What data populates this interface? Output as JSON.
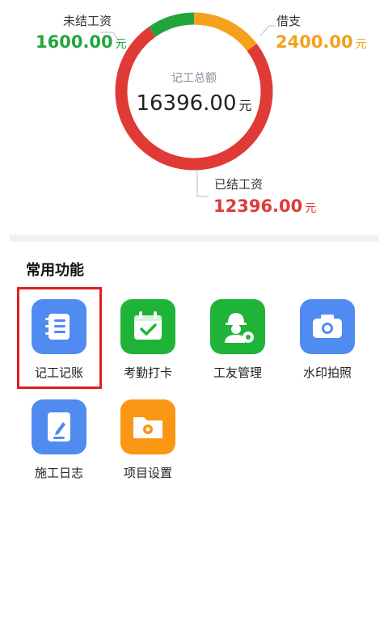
{
  "summary": {
    "center_label": "记工总额",
    "center_value": "16396.00",
    "currency_unit": "元",
    "segments": [
      {
        "key": "unsettled",
        "label": "未结工资",
        "value": "1600.00",
        "amount": 1600,
        "color": "#22a63c"
      },
      {
        "key": "advance",
        "label": "借支",
        "value": "2400.00",
        "amount": 2400,
        "color": "#f5a11b"
      },
      {
        "key": "settled",
        "label": "已结工资",
        "value": "12396.00",
        "amount": 12396,
        "color": "#e03a36"
      }
    ]
  },
  "functions": {
    "title": "常用功能",
    "items": [
      {
        "label": "记工记账",
        "icon": "notebook-icon",
        "color": "#4f8bf0",
        "selected": true
      },
      {
        "label": "考勤打卡",
        "icon": "calendar-check-icon",
        "color": "#1fb338"
      },
      {
        "label": "工友管理",
        "icon": "worker-gear-icon",
        "color": "#1fb338"
      },
      {
        "label": "水印拍照",
        "icon": "camera-icon",
        "color": "#4f8bf0"
      },
      {
        "label": "施工日志",
        "icon": "pen-document-icon",
        "color": "#4f8bf0"
      },
      {
        "label": "项目设置",
        "icon": "folder-gear-icon",
        "color": "#fb9615"
      }
    ]
  }
}
